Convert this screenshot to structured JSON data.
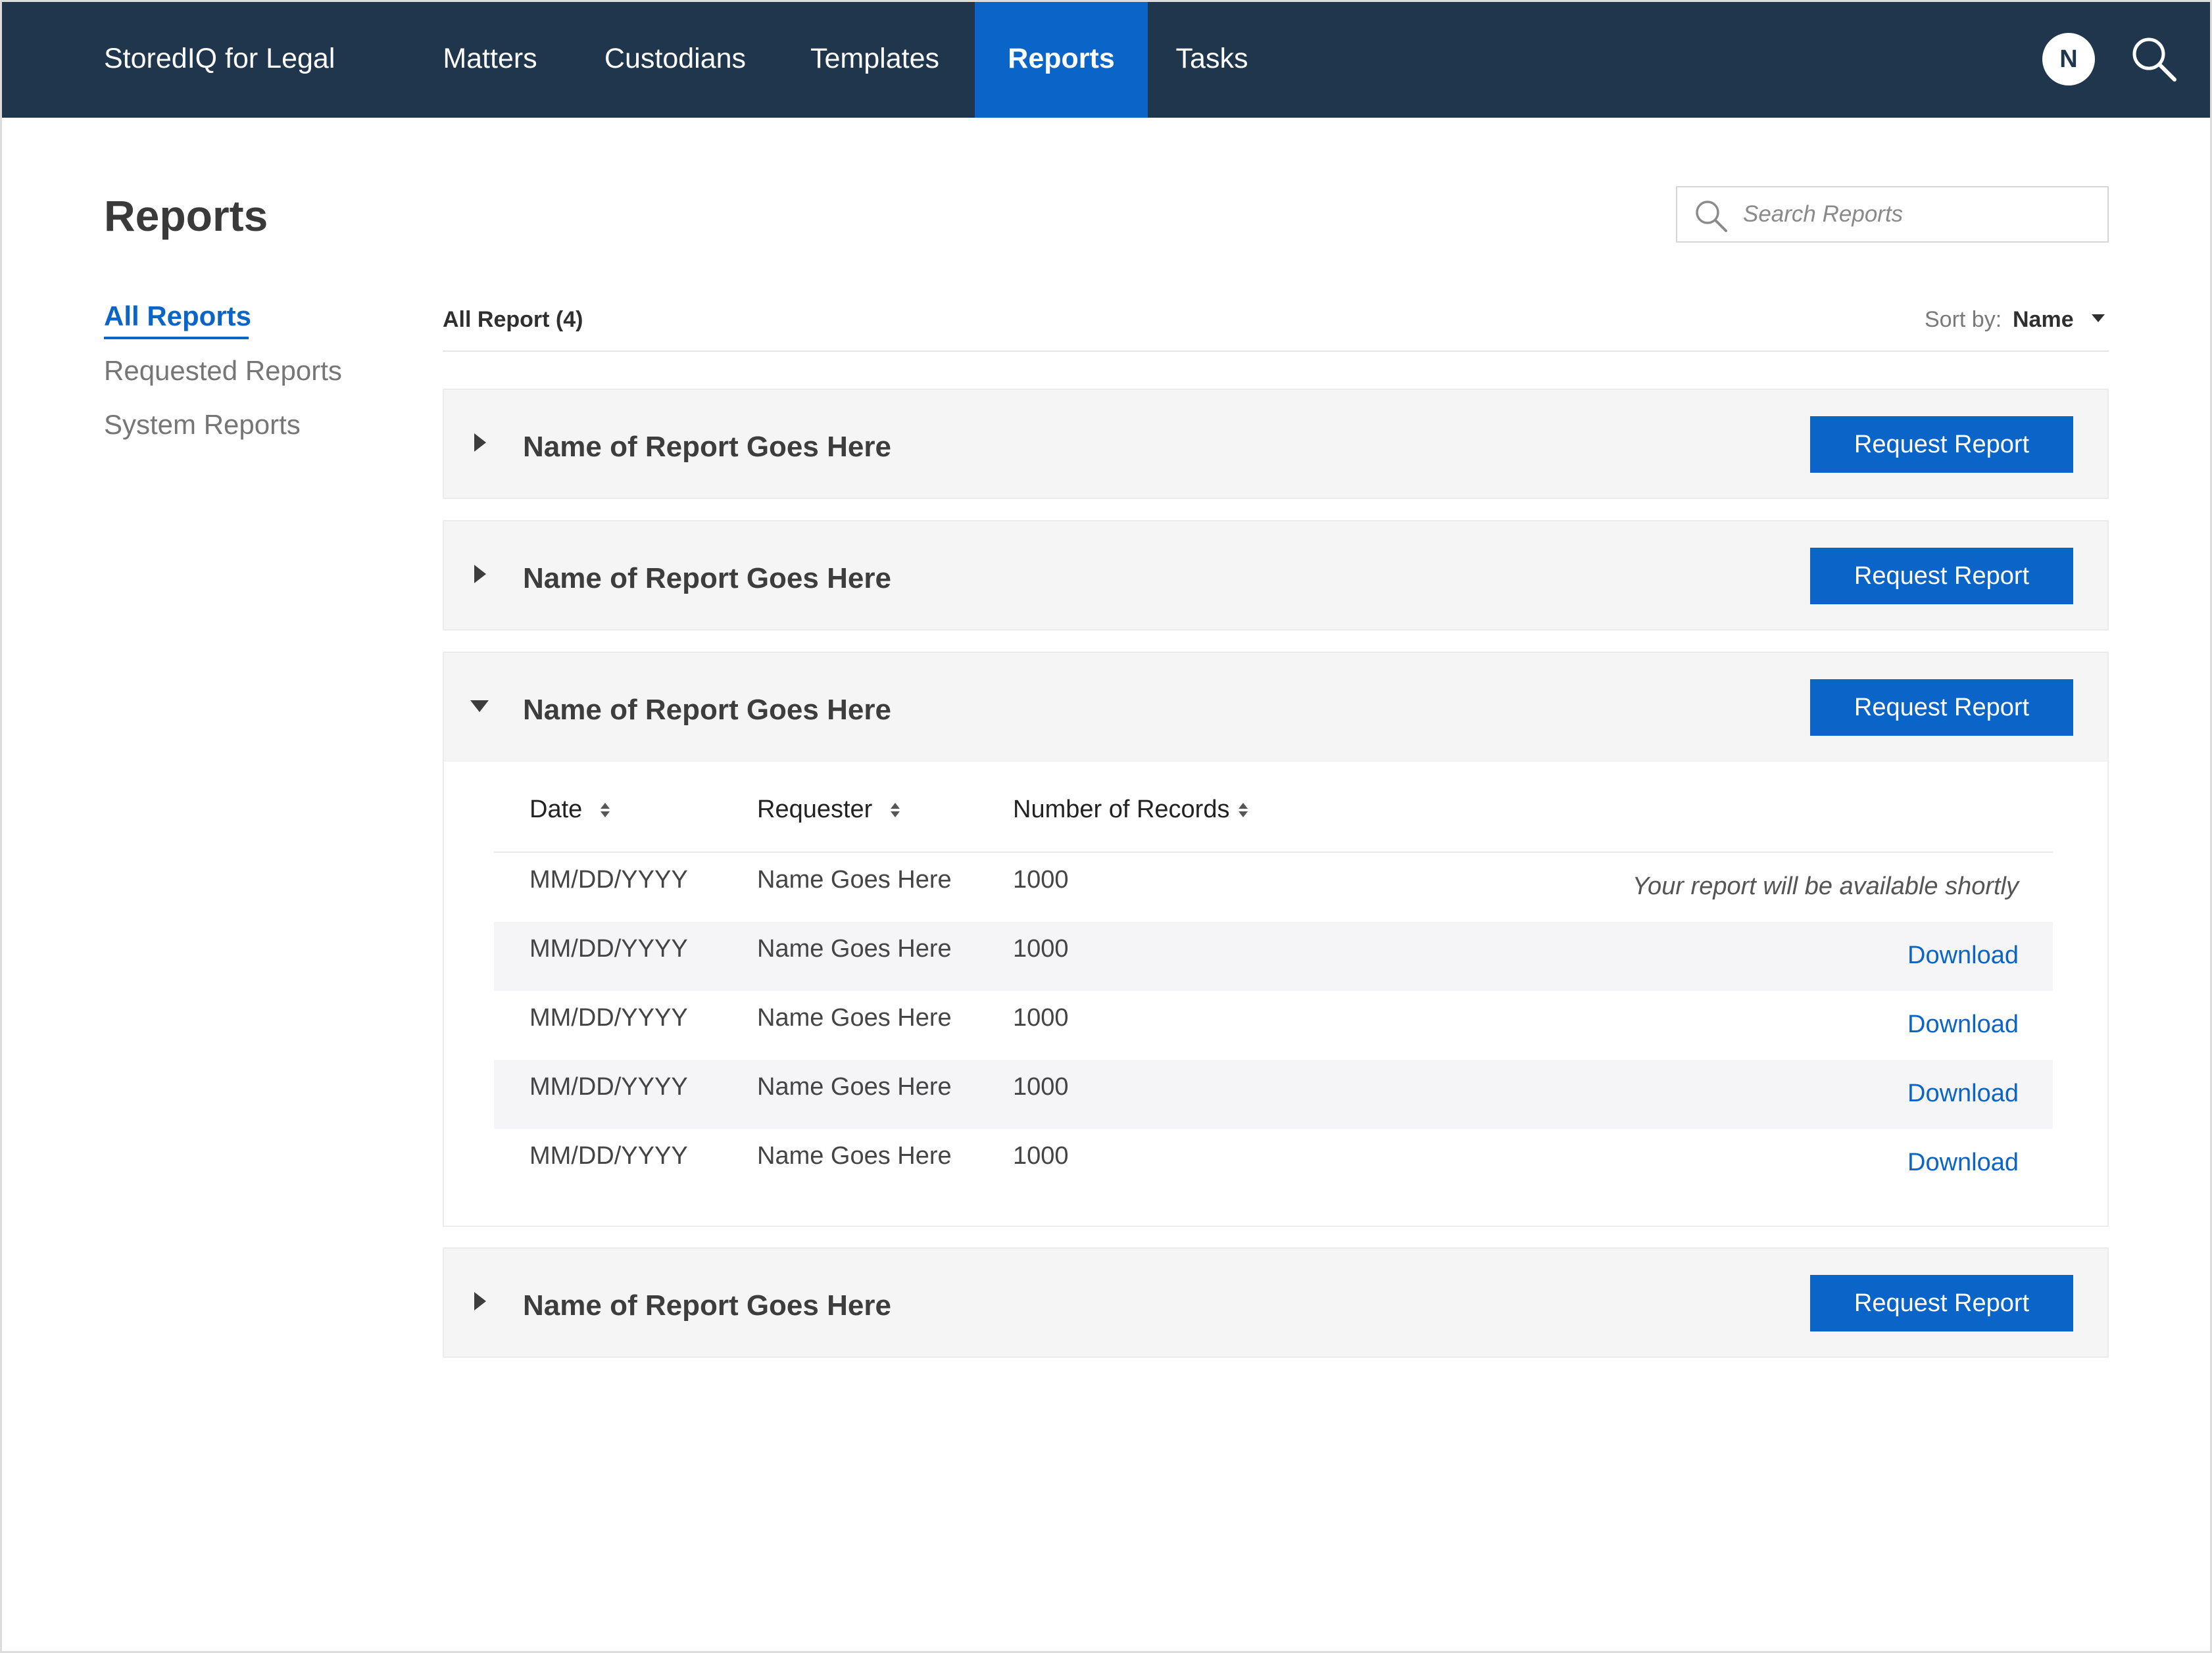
{
  "app": {
    "brand": "StoredIQ for Legal",
    "avatar_initial": "N",
    "accent_color": "#0b64c8",
    "header_bg": "#1f364d"
  },
  "nav": {
    "items": [
      "Matters",
      "Custodians",
      "Templates",
      "Reports",
      "Tasks"
    ],
    "active": "Reports"
  },
  "page": {
    "title": "Reports"
  },
  "search": {
    "placeholder": "Search Reports",
    "value": ""
  },
  "sidebar": {
    "items": [
      "All Reports",
      "Requested Reports",
      "System Reports"
    ],
    "active": "All Reports"
  },
  "list": {
    "count_label": "All Report (4)",
    "sort_label": "Sort by:",
    "sort_value": "Name"
  },
  "reports": [
    {
      "title": "Name of Report Goes Here",
      "button": "Request Report",
      "expanded": false
    },
    {
      "title": "Name of Report Goes Here",
      "button": "Request Report",
      "expanded": false
    },
    {
      "title": "Name of Report Goes Here",
      "button": "Request Report",
      "expanded": true
    },
    {
      "title": "Name of Report Goes Here",
      "button": "Request Report",
      "expanded": false
    }
  ],
  "table": {
    "columns": [
      "Date",
      "Requester",
      "Number of Records"
    ],
    "rows": [
      {
        "date": "MM/DD/YYYY",
        "requester": "Name Goes Here",
        "records": "1000",
        "action": "Your report will be available shortly"
      },
      {
        "date": "MM/DD/YYYY",
        "requester": "Name Goes Here",
        "records": "1000",
        "action": "Download"
      },
      {
        "date": "MM/DD/YYYY",
        "requester": "Name Goes Here",
        "records": "1000",
        "action": "Download"
      },
      {
        "date": "MM/DD/YYYY",
        "requester": "Name Goes Here",
        "records": "1000",
        "action": "Download"
      },
      {
        "date": "MM/DD/YYYY",
        "requester": "Name Goes Here",
        "records": "1000",
        "action": "Download"
      }
    ]
  }
}
